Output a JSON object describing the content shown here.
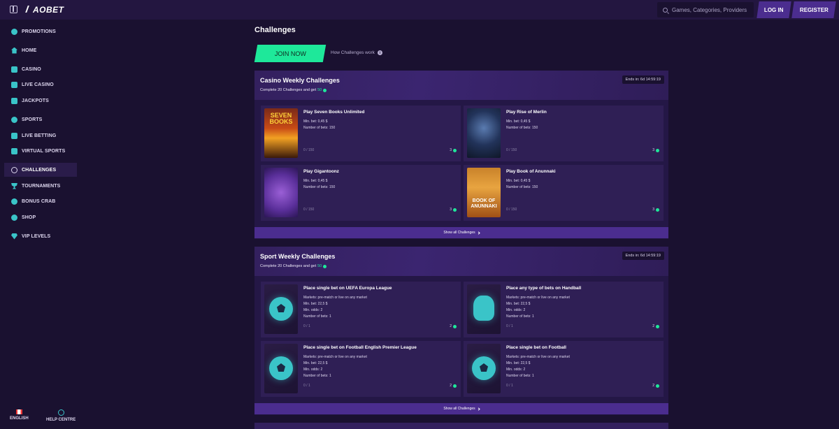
{
  "header": {
    "brand": "AOBET",
    "search_placeholder": "Games, Categories, Providers",
    "login_label": "LOG IN",
    "register_label": "REGISTER"
  },
  "sidebar": {
    "items": [
      {
        "label": "PROMOTIONS",
        "icon": "promotions-icon"
      },
      {
        "label": "HOME",
        "icon": "home-icon"
      },
      {
        "label": "CASINO",
        "icon": "casino-icon"
      },
      {
        "label": "LIVE CASINO",
        "icon": "live-casino-icon"
      },
      {
        "label": "JACKPOTS",
        "icon": "jackpots-icon"
      },
      {
        "label": "SPORTS",
        "icon": "sports-icon"
      },
      {
        "label": "LIVE BETTING",
        "icon": "live-betting-icon"
      },
      {
        "label": "VIRTUAL SPORTS",
        "icon": "virtual-sports-icon"
      },
      {
        "label": "CHALLENGES",
        "icon": "challenges-icon",
        "active": true
      },
      {
        "label": "TOURNAMENTS",
        "icon": "trophy-icon"
      },
      {
        "label": "BONUS CRAB",
        "icon": "bonus-crab-icon"
      },
      {
        "label": "SHOP",
        "icon": "shop-icon"
      },
      {
        "label": "VIP LEVELS",
        "icon": "diamond-icon"
      }
    ],
    "footer": {
      "language_label": "ENGLISH",
      "help_label": "HELP CENTRE"
    }
  },
  "main": {
    "title": "Challenges",
    "join_label": "JOIN NOW",
    "how_label": "How Challenges work",
    "accent": "#1ee89a",
    "sections": [
      {
        "title": "Casino Weekly Challenges",
        "subtitle_prefix": "Complete 20 Challenges and get",
        "reward": "50",
        "ends": "Ends in: 6d 14:59:19",
        "show_all": "Show all Challenges",
        "cards": [
          {
            "title": "Play Seven Books Unlimited",
            "lines": [
              "Min. bet: 0,45 $",
              "Number of bets: 150"
            ],
            "progress": "0 / 150",
            "reward": "3",
            "thumb_text": "SEVEN BOOKS"
          },
          {
            "title": "Play Rise of Merlin",
            "lines": [
              "Min. bet: 0,45 $",
              "Number of bets: 150"
            ],
            "progress": "0 / 150",
            "reward": "3",
            "thumb_text": ""
          },
          {
            "title": "Play Gigantoonz",
            "lines": [
              "Min. bet: 0,45 $",
              "Number of bets: 150"
            ],
            "progress": "0 / 150",
            "reward": "3",
            "thumb_text": ""
          },
          {
            "title": "Play Book of Anunnaki",
            "lines": [
              "Min. bet: 0,45 $",
              "Number of bets: 150"
            ],
            "progress": "0 / 150",
            "reward": "3",
            "thumb_text": "BOOK OF ANUNNAKI"
          }
        ]
      },
      {
        "title": "Sport Weekly Challenges",
        "subtitle_prefix": "Complete 20 Challenges and get",
        "reward": "50",
        "ends": "Ends in: 6d 14:59:19",
        "show_all": "Show all Challenges",
        "cards": [
          {
            "title": "Place single bet on UEFA Europa League",
            "lines": [
              "Markets: pre-match or live on any market",
              "Min. bet: 22,5 $",
              "Min. odds: 2",
              "Number of bets: 1"
            ],
            "progress": "0 / 1",
            "reward": "2"
          },
          {
            "title": "Place any type of bets on Handball",
            "lines": [
              "Markets: pre-match or live on any market",
              "Min. bet: 22,5 $",
              "Min. odds: 2",
              "Number of bets: 1"
            ],
            "progress": "0 / 1",
            "reward": "2"
          },
          {
            "title": "Place single bet on Football English Premier League",
            "lines": [
              "Markets: pre-match or live on any market",
              "Min. bet: 22,5 $",
              "Min. odds: 2",
              "Number of bets: 1"
            ],
            "progress": "0 / 1",
            "reward": "2"
          },
          {
            "title": "Place single bet on Football",
            "lines": [
              "Markets: pre-match or live on any market",
              "Min. bet: 22,5 $",
              "Min. odds: 2",
              "Number of bets: 1"
            ],
            "progress": "0 / 1",
            "reward": "2"
          }
        ]
      }
    ]
  }
}
